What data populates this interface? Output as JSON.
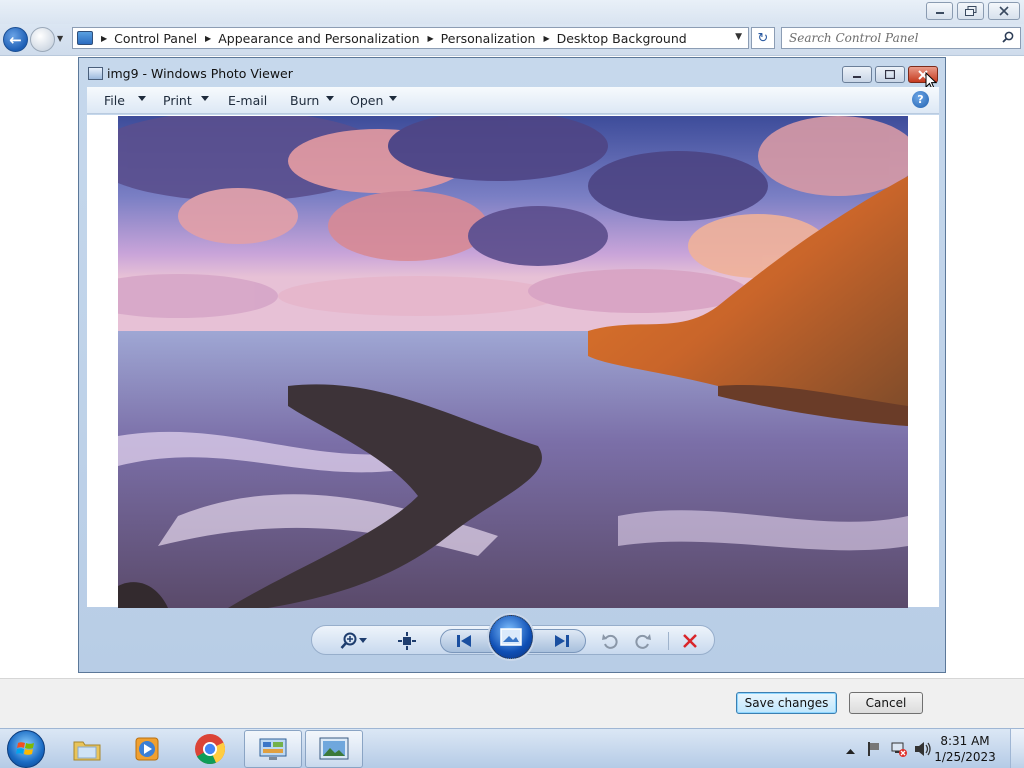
{
  "explorer": {
    "breadcrumbs": [
      "Control Panel",
      "Appearance and Personalization",
      "Personalization",
      "Desktop Background"
    ],
    "search_placeholder": "Search Control Panel",
    "save_label": "Save changes",
    "cancel_label": "Cancel"
  },
  "photo_viewer": {
    "title": "img9 - Windows Photo Viewer",
    "menu": {
      "file": "File",
      "print": "Print",
      "email": "E-mail",
      "burn": "Burn",
      "open": "Open"
    },
    "toolbar_icons": [
      "zoom-icon",
      "actual-size-icon",
      "previous-icon",
      "slideshow-icon",
      "next-icon",
      "rotate-counterclockwise-icon",
      "rotate-clockwise-icon",
      "delete-icon"
    ]
  },
  "taskbar": {
    "apps": [
      "windows-explorer",
      "windows-media-player",
      "google-chrome",
      "control-panel",
      "windows-photo-viewer"
    ],
    "time": "8:31 AM",
    "date": "1/25/2023"
  },
  "colors": {
    "accent": "#1d5fb6",
    "close_red": "#c63b20",
    "delete_red": "#d9262a"
  }
}
